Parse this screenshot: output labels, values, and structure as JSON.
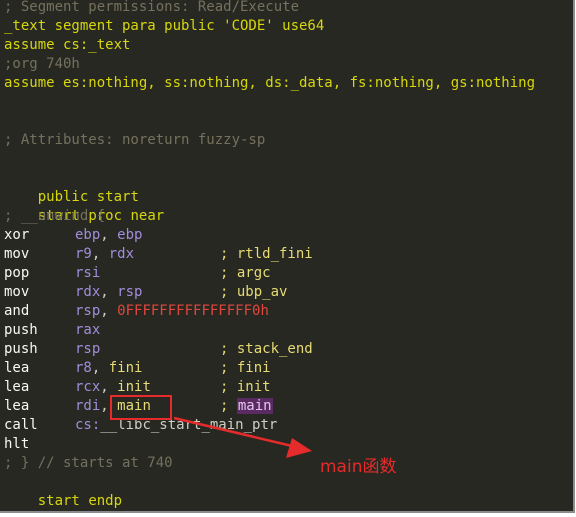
{
  "colors": {
    "background": "#272822",
    "comment": "#75715e",
    "keyword": "#d7d70d",
    "register": "#a28ddb",
    "symbol": "#e6db74",
    "number": "#e0473c",
    "annotation": "#e52b2b"
  },
  "listing": {
    "l0": "; Segment permissions: Read/Execute",
    "l1": "_text segment para public 'CODE' use64",
    "l2": "assume cs:_text",
    "l3": ";org 740h",
    "l4": "assume es:nothing, ss:nothing, ds:_data, fs:nothing, gs:nothing",
    "l7": "; Attributes: noreturn fuzzy-sp",
    "l9_a": "public",
    "l9_b": "start",
    "l10_a": "start",
    "l10_b": "proc near",
    "l11": "; __unwind {",
    "rows": [
      {
        "mn": "xor",
        "op1": "ebp",
        "sep": ", ",
        "op2": "ebp",
        "cm": ""
      },
      {
        "mn": "mov",
        "op1": "r9",
        "sep": ", ",
        "op2": "rdx",
        "cm": "; rtld_fini"
      },
      {
        "mn": "pop",
        "op1": "rsi",
        "sep": "",
        "op2": "",
        "cm": "; argc"
      },
      {
        "mn": "mov",
        "op1": "rdx",
        "sep": ", ",
        "op2": "rsp",
        "cm": "; ubp_av"
      },
      {
        "mn": "and",
        "op1": "rsp",
        "sep": ", ",
        "op2": "0FFFFFFFFFFFFFFF0h",
        "cm": ""
      },
      {
        "mn": "push",
        "op1": "rax",
        "sep": "",
        "op2": "",
        "cm": ""
      },
      {
        "mn": "push",
        "op1": "rsp",
        "sep": "",
        "op2": "",
        "cm": "; stack_end"
      },
      {
        "mn": "lea",
        "op1": "r8",
        "sep": ", ",
        "op2": "fini",
        "cm": "; fini"
      },
      {
        "mn": "lea",
        "op1": "rcx",
        "sep": ", ",
        "op2": "init",
        "cm": "; init"
      },
      {
        "mn": "lea",
        "op1": "rdi",
        "sep": ", ",
        "op2": "main",
        "cm": "; ",
        "cm2": "main"
      },
      {
        "mn": "call",
        "op1": "cs:",
        "sep": "",
        "op2": "__libc_start_main_ptr",
        "cm": ""
      },
      {
        "mn": "hlt",
        "op1": "",
        "sep": "",
        "op2": "",
        "cm": ""
      }
    ],
    "l24": "; } // starts at 740",
    "l25_a": "start",
    "l25_b": "endp"
  },
  "annotation": {
    "text": "main函数"
  }
}
